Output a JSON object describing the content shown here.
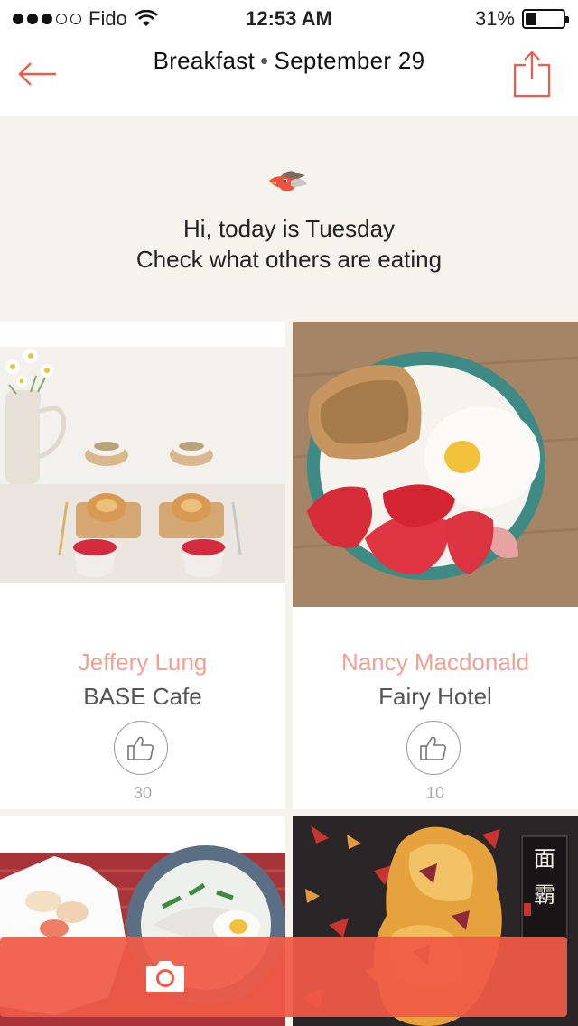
{
  "status_bar": {
    "carrier": "Fido",
    "time": "12:53 AM",
    "battery": "31%",
    "battery_level": 0.31
  },
  "nav": {
    "meal": "Breakfast",
    "separator": "•",
    "date": "September 29",
    "back_icon": "arrow-left-icon",
    "share_icon": "share-icon"
  },
  "greeting": {
    "line1": "Hi, today is Tuesday",
    "line2": "Check what others are eating",
    "icon": "bird-icon"
  },
  "posts": [
    {
      "name": "Jeffery Lung",
      "place": "BASE Cafe",
      "likes": "30"
    },
    {
      "name": "Nancy Macdonald",
      "place": "Fairy Hotel",
      "likes": "10"
    }
  ],
  "camera": {
    "icon": "camera-icon"
  },
  "colors": {
    "accent": "#f05a46",
    "name": "#f0a193",
    "background": "#f5f3ec"
  }
}
